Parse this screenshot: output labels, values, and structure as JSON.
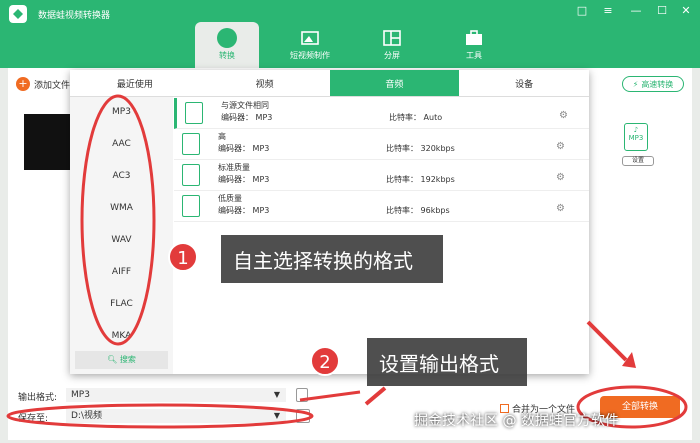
{
  "app": {
    "title": "数据蛙视频转换器"
  },
  "window_controls": [
    "□",
    "≡",
    "—",
    "☐",
    "✕"
  ],
  "tabs": [
    {
      "label": "转换"
    },
    {
      "label": "短视频制作"
    },
    {
      "label": "分屏"
    },
    {
      "label": "工具"
    }
  ],
  "toolbar": {
    "add_file": "添加文件",
    "fast_convert": "高速转换"
  },
  "format_icon": {
    "label": "MP3",
    "settings": "设置"
  },
  "panel": {
    "tabs": [
      "最近使用",
      "视频",
      "音频",
      "设备"
    ],
    "formats": [
      "MP3",
      "AAC",
      "AC3",
      "WMA",
      "WAV",
      "AIFF",
      "FLAC",
      "MKA"
    ],
    "search": "搜索",
    "qualities": [
      {
        "name": "与源文件相同",
        "encoder": "编码器：  MP3",
        "bitrate": "比特率：  Auto"
      },
      {
        "name": "高",
        "encoder": "编码器：  MP3",
        "bitrate": "比特率：  320kbps"
      },
      {
        "name": "标准质量",
        "encoder": "编码器：  MP3",
        "bitrate": "比特率：  192kbps"
      },
      {
        "name": "低质量",
        "encoder": "编码器：  MP3",
        "bitrate": "比特率：  96kbps"
      }
    ]
  },
  "output": {
    "format_label": "输出格式:",
    "format_value": "MP3",
    "save_label": "保存至:",
    "save_value": "D:\\视频",
    "merge": "合并为一个文件",
    "convert_all": "全部转换"
  },
  "annotations": {
    "num1": "1",
    "text1": "自主选择转换的格式",
    "num2": "2",
    "text2": "设置输出格式"
  },
  "watermark": "掘金技术社区 @ 数据蛙官方软件",
  "colors": {
    "brand": "#2bb673",
    "accent": "#f06b22",
    "annotation": "#e23b3b"
  }
}
